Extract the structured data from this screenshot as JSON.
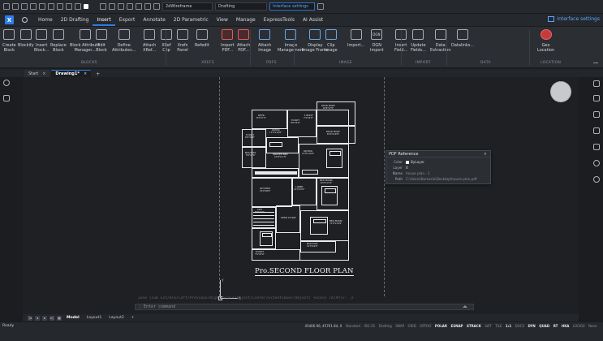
{
  "qat": {
    "layer_state": "2dWireframe",
    "workspace": "Drafting",
    "interface_settings_field": "Interface settings"
  },
  "menubar": {
    "logo": "X",
    "items": [
      "Home",
      "2D Drafting",
      "Insert",
      "Export",
      "Annotate",
      "2D Parametric",
      "View",
      "Manage",
      "ExpressTools",
      "AI Assist"
    ],
    "active": "Insert",
    "interface_settings": "Interface settings"
  },
  "ribbon": {
    "buttons": [
      {
        "label": "Create\nBlock",
        "name": "create-block"
      },
      {
        "label": "Blockify",
        "name": "blockify"
      },
      {
        "label": "Insert\nBlock...",
        "name": "insert-block"
      },
      {
        "label": "Replace\nBlock",
        "name": "replace-block"
      },
      {
        "label": "Block Attribute\nManager...",
        "name": "block-attribute-manager"
      },
      {
        "label": "Edit\nBlock",
        "name": "edit-block"
      },
      {
        "label": "Define\nAttributes...",
        "name": "define-attributes"
      },
      {
        "label": "Attach\nXRef...",
        "name": "attach-xref"
      },
      {
        "label": "XRef\nClip",
        "name": "xref-clip"
      },
      {
        "label": "Xrefs\nPanel",
        "name": "xrefs-panel"
      },
      {
        "label": "Refedit",
        "name": "refedit"
      },
      {
        "label": "Import\nPDF...",
        "name": "import-pdf"
      },
      {
        "label": "Attach\nPDF...",
        "name": "attach-pdf"
      },
      {
        "label": "Attach\nImage",
        "name": "attach-image"
      },
      {
        "label": "Image\nManagement",
        "name": "image-management"
      },
      {
        "label": "Display\nImage Frame",
        "name": "display-image-frame"
      },
      {
        "label": "Clip\nImage",
        "name": "clip-image"
      },
      {
        "label": "Import...",
        "name": "import"
      },
      {
        "label": "DGN\nImport",
        "name": "dgn-import"
      },
      {
        "label": "Insert\nField...",
        "name": "insert-field"
      },
      {
        "label": "Update\nFields...",
        "name": "update-fields"
      },
      {
        "label": "Data\nExtraction",
        "name": "data-extraction"
      },
      {
        "label": "Datalinks...",
        "name": "datalinks"
      },
      {
        "label": "Geo\nLocation",
        "name": "geo-location"
      }
    ],
    "dgn_badge": "DGN",
    "groups": [
      "BLOCKS",
      "XREFS",
      "PDFS",
      "IMAGE",
      "IMPORT",
      "DATA",
      "LOCATION"
    ]
  },
  "tabs": {
    "items": [
      {
        "label": "Start",
        "active": false
      },
      {
        "label": "Drawing1*",
        "active": true
      }
    ],
    "close": "×",
    "add": "+"
  },
  "plan": {
    "title": "Pro.SECOND FLOOR PLAN",
    "rooms": [
      {
        "label": "DECK ROOF\n16'9\"x7'9\""
      },
      {
        "label": "DECK\n8'3\"x7'3\""
      },
      {
        "label": "TOILET\n8'0\"x5'0\""
      },
      {
        "label": "T. ROOF\n7'2\"x5'0\""
      },
      {
        "label": "LIVING\n11'0\"x10'6\""
      },
      {
        "label": "DECK ROOF\n10'3\"x10'9\""
      },
      {
        "label": "TOILET\n8'0\"x5'0\""
      },
      {
        "label": "MASTER BED\n12'9\"x11'6\""
      },
      {
        "label": "BALCONY\n5'0\"x4'6\""
      },
      {
        "label": "DINING\n12'6\"x10'6\""
      },
      {
        "label": "KITCHEN\n10'0\"x8'0\""
      },
      {
        "label": "LOBBY\n12'0\"x5'0\""
      },
      {
        "label": "BED ROOM\n12'3\"x11'0\""
      },
      {
        "label": "LIFT\n6'0\"x5'0\""
      },
      {
        "label": "OPEN TO SKY"
      },
      {
        "label": "BED ROOM\n11'6\"x10'9\""
      },
      {
        "label": "TOILET\n7'0\"x5'0\""
      },
      {
        "label": "BALCONY\n12'0\"x4'0\""
      }
    ]
  },
  "pdf_ref": {
    "title": "PDF Reference",
    "close": "×",
    "rows": [
      {
        "key": "Color",
        "value": "ByLayer"
      },
      {
        "key": "Layer",
        "value": "0"
      },
      {
        "key": "Name",
        "value": "house plan - 1"
      },
      {
        "key": "Path",
        "value": "C:\\Users\\Kumarla\\Desktop\\house plan.pdf"
      }
    ]
  },
  "ucs": {
    "x": "X",
    "y": "Y"
  },
  "cmd": {
    "history": "Zone [sum Ext/Blk/Left/Previous/Right/Scale/Object/Center/ExtentsOver/Object] <Scale (X/XP)>: _e",
    "placeholder": "Enter command"
  },
  "layout_tabs": {
    "items": [
      "Model",
      "Layout1",
      "Layout2"
    ],
    "active": "Model",
    "add": "+"
  },
  "status": {
    "left": "Ready",
    "coords": "45466.96, 45761.84, 0",
    "items": [
      {
        "label": "Standard",
        "on": false
      },
      {
        "label": "ISO-25",
        "on": false
      },
      {
        "label": "Drafting",
        "on": false
      },
      {
        "label": "SNAP",
        "on": false
      },
      {
        "label": "GRID",
        "on": false
      },
      {
        "label": "ORTHO",
        "on": false
      },
      {
        "label": "POLAR",
        "on": true
      },
      {
        "label": "ESNAP",
        "on": true
      },
      {
        "label": "STRACK",
        "on": true
      },
      {
        "label": "LWT",
        "on": false
      },
      {
        "label": "TILE",
        "on": false
      },
      {
        "label": "1:1",
        "on": true
      },
      {
        "label": "DUCS",
        "on": false
      },
      {
        "label": "DYN",
        "on": true
      },
      {
        "label": "QUAD",
        "on": true
      },
      {
        "label": "RT",
        "on": true
      },
      {
        "label": "HKA",
        "on": true
      },
      {
        "label": "LOCKUI",
        "on": false
      },
      {
        "label": "None",
        "on": false
      }
    ]
  }
}
